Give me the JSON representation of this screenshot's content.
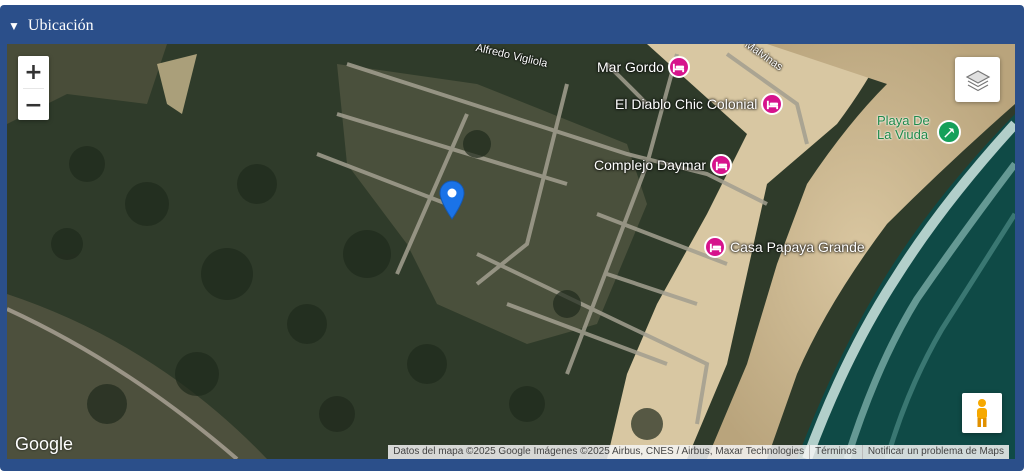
{
  "section": {
    "title": "Ubicación",
    "toggle_glyph": "▼"
  },
  "map": {
    "zoom_in": "+",
    "zoom_out": "−",
    "logo": "Google",
    "roads": [
      "Alfredo Vigliola",
      "Malvinas"
    ],
    "places": [
      {
        "name": "Mar Gordo",
        "icon": "hotel-icon"
      },
      {
        "name": "El Diablo Chic Colonial",
        "icon": "hotel-icon"
      },
      {
        "name": "Complejo Daymar",
        "icon": "hotel-icon"
      },
      {
        "name": "Casa Papaya Grande",
        "icon": "hotel-icon"
      }
    ],
    "beach": {
      "line1": "Playa De",
      "line2": "La Viuda",
      "icon": "beach-icon"
    },
    "attribution": "Datos del mapa ©2025 Google Imágenes ©2025 Airbus, CNES / Airbus, Maxar Technologies",
    "terms": "Términos",
    "report": "Notificar un problema de Maps",
    "colors": {
      "header": "#2b4f8a",
      "poi": "#d6138c",
      "marker": "#1a73e8",
      "beach": "#15a05a"
    }
  }
}
